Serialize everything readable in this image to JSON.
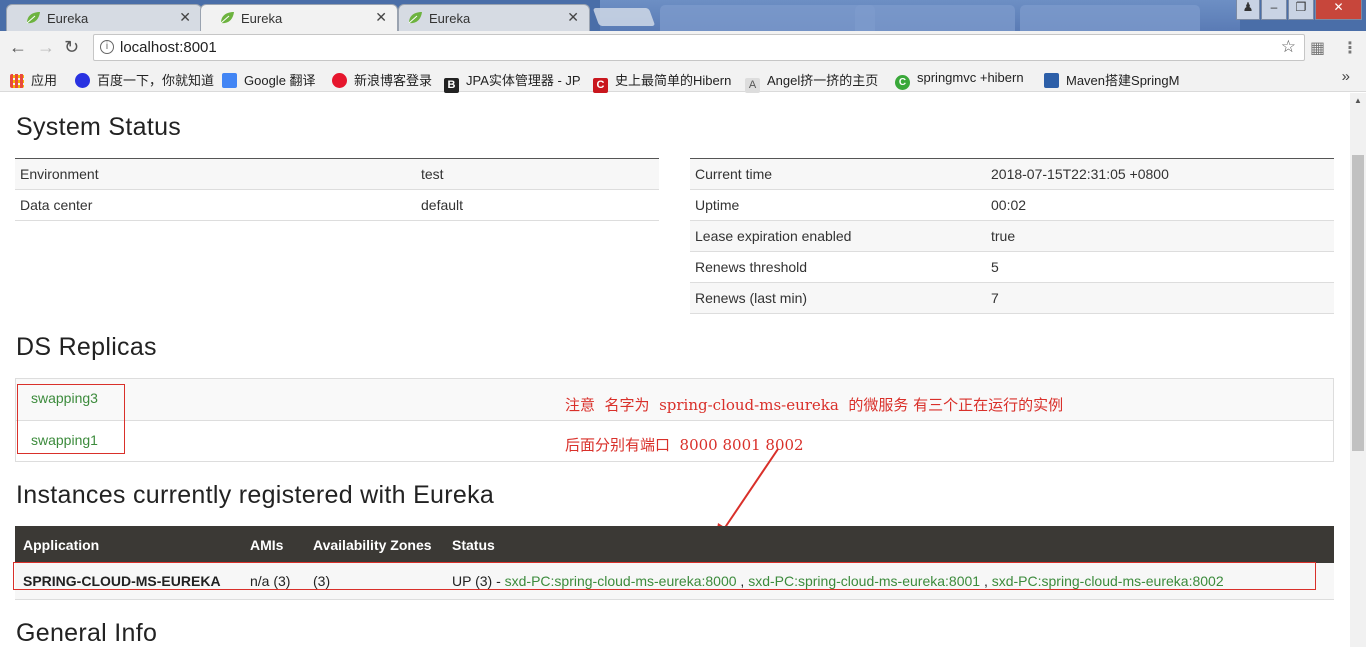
{
  "browser": {
    "tabs": [
      {
        "title": "Eureka",
        "active": false
      },
      {
        "title": "Eureka",
        "active": true
      },
      {
        "title": "Eureka",
        "active": false
      }
    ],
    "tab_close_glyph": "✕",
    "url": "localhost:8001",
    "bookmarks": [
      {
        "label": "应用",
        "icon": "apps-grid-icon",
        "color": "#4285f4"
      },
      {
        "label": "百度一下，你就知道",
        "icon": "baidu-paw-icon",
        "color": "#2932e1"
      },
      {
        "label": "Google 翻译",
        "icon": "google-translate-icon",
        "color": "#4285f4"
      },
      {
        "label": "新浪博客登录",
        "icon": "weibo-icon",
        "color": "#e6162d"
      },
      {
        "label": "JPA实体管理器 - JPA",
        "icon": "b-letter-icon",
        "color": "#222222"
      },
      {
        "label": "史上最简单的Hibern",
        "icon": "csdn-c-icon",
        "color": "#c9171e"
      },
      {
        "label": "Angel挤一挤的主页",
        "icon": "angel-icon",
        "color": "#555555"
      },
      {
        "label": "springmvc +hibern",
        "icon": "green-c-icon",
        "color": "#3aa83a"
      },
      {
        "label": "Maven搭建SpringM",
        "icon": "cnblogs-icon",
        "color": "#2d5fa8"
      }
    ],
    "bookmarks_more": "»"
  },
  "system_status": {
    "heading": "System Status",
    "left": [
      {
        "key": "Environment",
        "value": "test"
      },
      {
        "key": "Data center",
        "value": "default"
      }
    ],
    "right": [
      {
        "key": "Current time",
        "value": "2018-07-15T22:31:05 +0800"
      },
      {
        "key": "Uptime",
        "value": "00:02"
      },
      {
        "key": "Lease expiration enabled",
        "value": "true"
      },
      {
        "key": "Renews threshold",
        "value": "5"
      },
      {
        "key": "Renews (last min)",
        "value": "7"
      }
    ]
  },
  "ds_replicas": {
    "heading": "DS Replicas",
    "items": [
      "swapping3",
      "swapping1"
    ]
  },
  "annotation": {
    "line1": "注意  名字为  spring-cloud-ms-eureka  的微服务 有三个正在运行的实例",
    "line2": "后面分别有端口  8000 8001 8002",
    "color": "#d9302a"
  },
  "instances": {
    "heading": "Instances currently registered with Eureka",
    "columns": [
      "Application",
      "AMIs",
      "Availability Zones",
      "Status"
    ],
    "rows": [
      {
        "application": "SPRING-CLOUD-MS-EUREKA",
        "amis": "n/a (3)",
        "zones": "(3)",
        "status_prefix": "UP (3) - ",
        "links": [
          "sxd-PC:spring-cloud-ms-eureka:8000",
          "sxd-PC:spring-cloud-ms-eureka:8001",
          "sxd-PC:spring-cloud-ms-eureka:8002"
        ],
        "separator": " , "
      }
    ]
  },
  "general_info": {
    "heading": "General Info"
  }
}
